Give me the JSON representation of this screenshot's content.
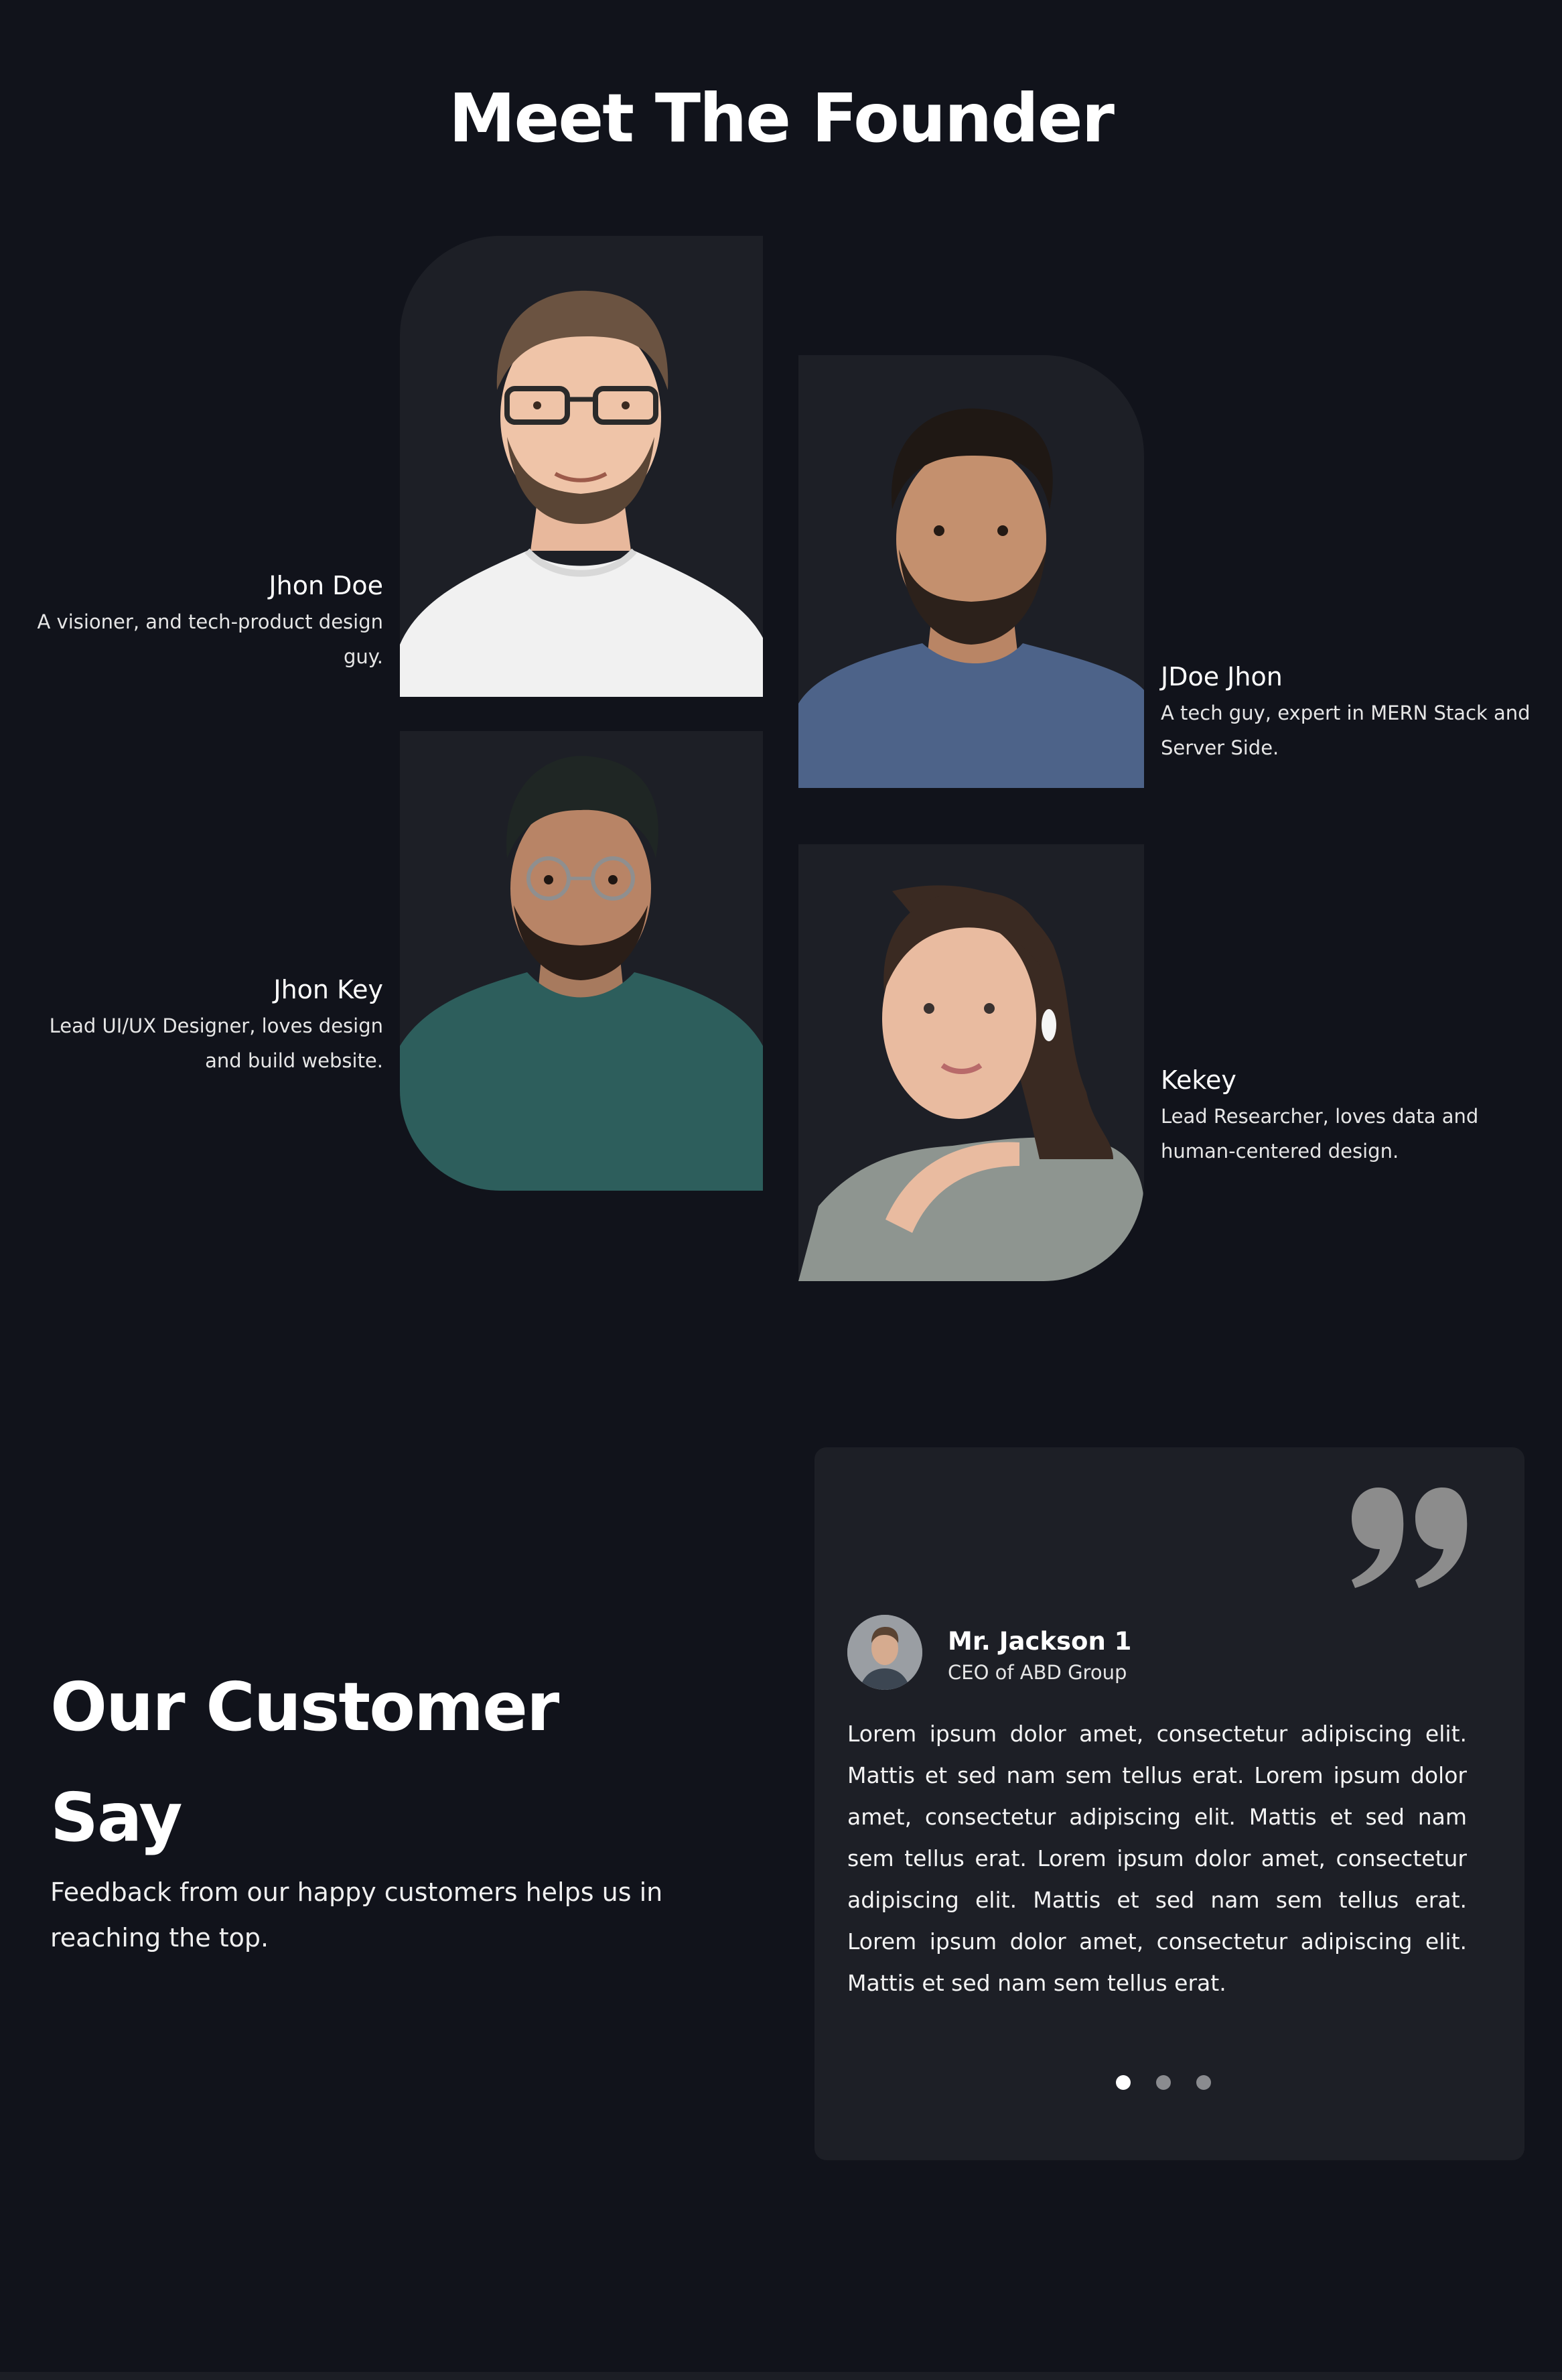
{
  "founders": {
    "title": "Meet The Founder",
    "members": [
      {
        "name": "Jhon Doe",
        "desc_lines": [
          "A visioner, and tech-product design",
          "guy."
        ]
      },
      {
        "name": "JDoe Jhon",
        "desc_lines": [
          "A tech guy, expert in MERN Stack and",
          "Server Side."
        ]
      },
      {
        "name": "Jhon Key",
        "desc_lines": [
          "Lead UI/UX Designer, loves design",
          "and build website."
        ]
      },
      {
        "name": "Kekey",
        "desc_lines": [
          "Lead Researcher, loves data and",
          "human-centered design."
        ]
      }
    ]
  },
  "testimonials": {
    "title_lines": [
      "Our Customer",
      "Say"
    ],
    "subtitle_lines": [
      "Feedback from our happy customers helps us in",
      "reaching the top."
    ],
    "active_review": {
      "author": "Mr. Jackson 1",
      "role": "CEO of ABD Group",
      "text": "Lorem ipsum dolor amet, consectetur adipiscing elit. Mattis et sed nam sem tellus erat. Lorem ipsum dolor amet, consectetur adipiscing elit. Mattis et sed nam sem tellus erat. Lorem ipsum dolor amet, consectetur adipiscing elit. Mattis et sed nam sem tellus erat. Lorem ipsum dolor amet, consectetur adipiscing elit. Mattis et sed nam sem tellus erat."
    },
    "slide_count": 3,
    "active_slide": 1
  },
  "icons": {
    "quote": "quote-icon",
    "pagination": "pagination-dot"
  },
  "colors": {
    "background": "#11131b",
    "card": "#1d1f26",
    "text": "#ffffff",
    "muted_dot": "#8a8b8f",
    "quote": "#8c8c8c"
  }
}
